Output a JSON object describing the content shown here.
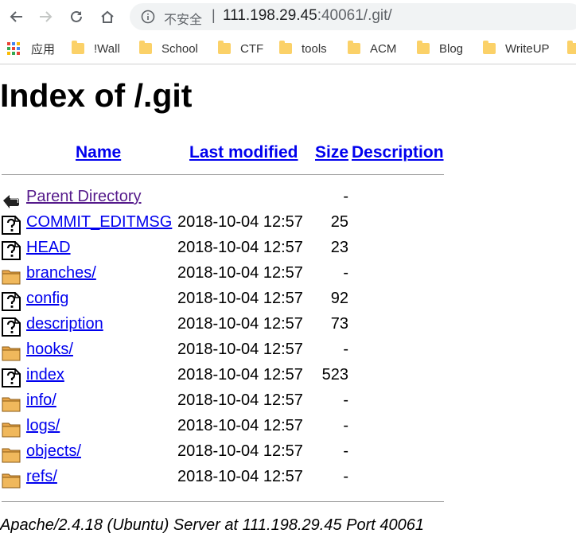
{
  "browser": {
    "security_label": "不安全",
    "url_host": "111.198.29.45",
    "url_port_path": ":40061/.git/",
    "bookmarks": [
      {
        "label": "应用",
        "icon": "apps-grid-icon"
      },
      {
        "label": "!Wall",
        "icon": "folder-icon"
      },
      {
        "label": "School",
        "icon": "folder-icon"
      },
      {
        "label": "CTF",
        "icon": "folder-icon"
      },
      {
        "label": "tools",
        "icon": "folder-icon"
      },
      {
        "label": "ACM",
        "icon": "folder-icon"
      },
      {
        "label": "Blog",
        "icon": "folder-icon"
      },
      {
        "label": "WriteUP",
        "icon": "folder-icon"
      }
    ]
  },
  "page": {
    "title": "Index of /.git",
    "headers": {
      "name": "Name",
      "last_modified": "Last modified",
      "size": "Size",
      "description": "Description"
    },
    "entries": [
      {
        "name": "Parent Directory",
        "modified": "",
        "size": "-",
        "icon": "back-arrow-icon",
        "visited": true
      },
      {
        "name": "COMMIT_EDITMSG",
        "modified": "2018-10-04 12:57",
        "size": "25",
        "icon": "unknown-file-icon"
      },
      {
        "name": "HEAD",
        "modified": "2018-10-04 12:57",
        "size": "23",
        "icon": "unknown-file-icon"
      },
      {
        "name": "branches/",
        "modified": "2018-10-04 12:57",
        "size": "-",
        "icon": "folder-icon"
      },
      {
        "name": "config",
        "modified": "2018-10-04 12:57",
        "size": "92",
        "icon": "unknown-file-icon"
      },
      {
        "name": "description",
        "modified": "2018-10-04 12:57",
        "size": "73",
        "icon": "unknown-file-icon"
      },
      {
        "name": "hooks/",
        "modified": "2018-10-04 12:57",
        "size": "-",
        "icon": "folder-icon"
      },
      {
        "name": "index",
        "modified": "2018-10-04 12:57",
        "size": "523",
        "icon": "unknown-file-icon"
      },
      {
        "name": "info/",
        "modified": "2018-10-04 12:57",
        "size": "-",
        "icon": "folder-icon"
      },
      {
        "name": "logs/",
        "modified": "2018-10-04 12:57",
        "size": "-",
        "icon": "folder-icon"
      },
      {
        "name": "objects/",
        "modified": "2018-10-04 12:57",
        "size": "-",
        "icon": "folder-icon"
      },
      {
        "name": "refs/",
        "modified": "2018-10-04 12:57",
        "size": "-",
        "icon": "folder-icon"
      }
    ],
    "footer": "Apache/2.4.18 (Ubuntu) Server at 111.198.29.45 Port 40061"
  }
}
